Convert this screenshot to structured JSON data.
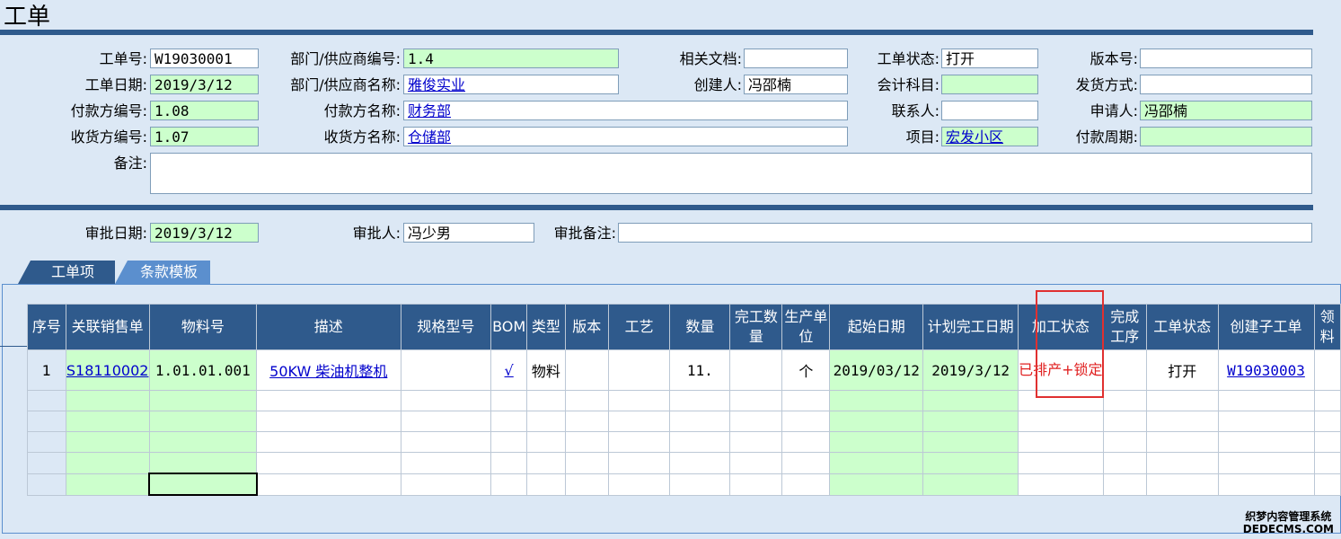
{
  "page": {
    "title": "工单"
  },
  "form": {
    "order_no": {
      "label": "工单号:",
      "value": "W19030001"
    },
    "dept_code": {
      "label": "部门/供应商编号:",
      "value": "1.4"
    },
    "related_doc": {
      "label": "相关文档:",
      "value": ""
    },
    "order_status": {
      "label": "工单状态:",
      "value": "打开"
    },
    "version_no": {
      "label": "版本号:",
      "value": ""
    },
    "order_date": {
      "label": "工单日期:",
      "value": "2019/3/12"
    },
    "dept_name": {
      "label": "部门/供应商名称:",
      "value": "雅俊实业"
    },
    "creator": {
      "label": "创建人:",
      "value": "冯邵楠"
    },
    "account": {
      "label": "会计科目:",
      "value": ""
    },
    "ship_method": {
      "label": "发货方式:",
      "value": ""
    },
    "payer_code": {
      "label": "付款方编号:",
      "value": "1.08"
    },
    "payer_name": {
      "label": "付款方名称:",
      "value": "财务部"
    },
    "contact": {
      "label": "联系人:",
      "value": ""
    },
    "applicant": {
      "label": "申请人:",
      "value": "冯邵楠"
    },
    "receiver_code": {
      "label": "收货方编号:",
      "value": "1.07"
    },
    "receiver_name": {
      "label": "收货方名称:",
      "value": "仓储部"
    },
    "project": {
      "label": "项目:",
      "value": "宏发小区"
    },
    "pay_period": {
      "label": "付款周期:",
      "value": ""
    },
    "remark": {
      "label": "备注:",
      "value": ""
    }
  },
  "approval": {
    "date": {
      "label": "审批日期:",
      "value": "2019/3/12"
    },
    "approver": {
      "label": "审批人:",
      "value": "冯少男"
    },
    "note": {
      "label": "审批备注:",
      "value": ""
    }
  },
  "tabs": [
    {
      "label": "工单项"
    },
    {
      "label": "条款模板"
    }
  ],
  "grid": {
    "columns": [
      "序号",
      "关联销售单",
      "物料号",
      "描述",
      "规格型号",
      "BOM",
      "类型",
      "版本",
      "工艺",
      "数量",
      "完工数量",
      "生产单位",
      "起始日期",
      "计划完工日期",
      "加工状态",
      "完成工序",
      "工单状态",
      "创建子工单",
      "领料"
    ],
    "rows": [
      {
        "seq": "1",
        "sales_order": "S18110002",
        "material_no": "1.01.01.001",
        "description": "50KW 柴油机整机",
        "spec": "",
        "bom": "√",
        "type": "物料",
        "version": "",
        "process": "",
        "qty": "11.",
        "done_qty": "",
        "unit": "个",
        "start_date": "2019/03/12",
        "plan_date": "2019/3/12",
        "proc_status": "已排产+锁定",
        "done_step": "",
        "order_status": "打开",
        "sub_order": "W19030003",
        "pick": ""
      }
    ]
  },
  "watermark": {
    "line1": "织梦内容管理系统",
    "line2": "DEDECMS.COM"
  },
  "colors": {
    "header_blue": "#2f5a8c",
    "tab_light": "#5b8fce",
    "green_field": "#ccffcc",
    "background": "#dce8f5",
    "highlight_red": "#e03030"
  }
}
